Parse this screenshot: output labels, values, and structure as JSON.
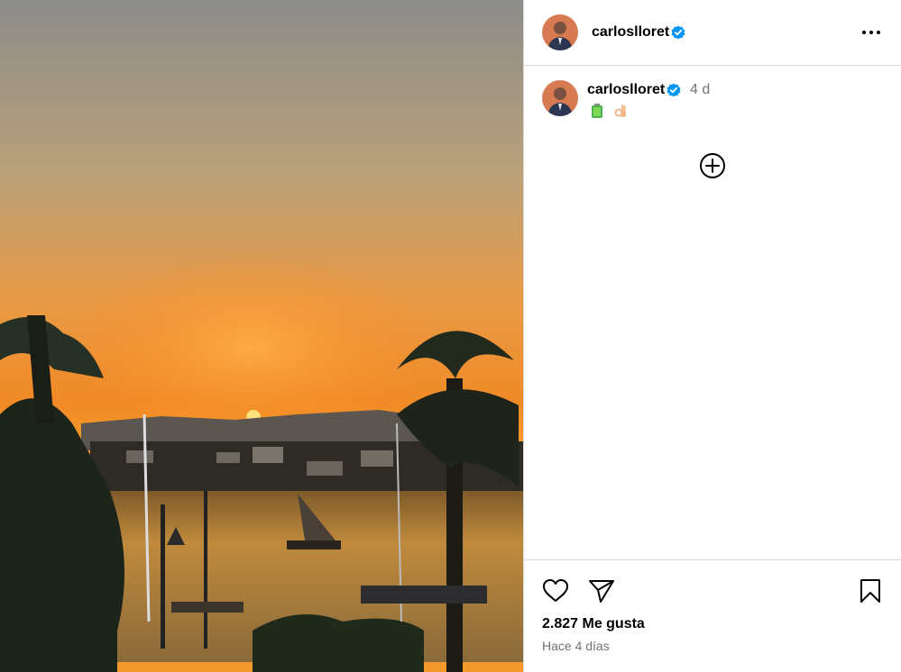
{
  "post": {
    "author": {
      "username": "carloslloret",
      "verified": true
    },
    "caption": {
      "username": "carloslloret",
      "time": "4 d",
      "emojis": [
        "battery-emoji",
        "ok-hand-emoji"
      ]
    },
    "likes_label": "2.827 Me gusta",
    "time_ago": "Hace 4 días"
  },
  "icons": {
    "more": "more-options-icon",
    "add_comment": "plus-circle-icon",
    "like": "heart-icon",
    "share": "paper-plane-icon",
    "save": "bookmark-icon"
  },
  "colors": {
    "verified": "#0095f6",
    "muted_text": "#737373",
    "divider": "#dbdbdb"
  }
}
